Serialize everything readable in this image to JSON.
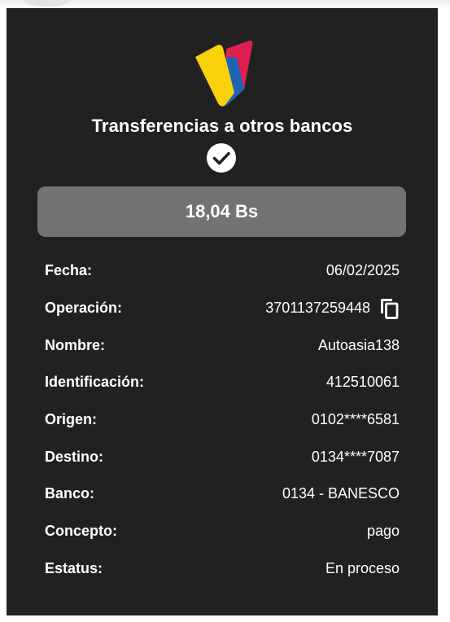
{
  "header": {
    "title": "Transferencias a otros bancos"
  },
  "summary": {
    "amount": "18,04 Bs"
  },
  "details": [
    {
      "label": "Fecha:",
      "value": "06/02/2025"
    },
    {
      "label": "Operación:",
      "value": "3701137259448"
    },
    {
      "label": "Nombre:",
      "value": "Autoasia138"
    },
    {
      "label": "Identificación:",
      "value": "412510061"
    },
    {
      "label": "Origen:",
      "value": "0102****6581"
    },
    {
      "label": "Destino:",
      "value": "0134****7087"
    },
    {
      "label": "Banco:",
      "value": "0134 - BANESCO"
    },
    {
      "label": "Concepto:",
      "value": "pago"
    },
    {
      "label": "Estatus:",
      "value": "En proceso"
    }
  ],
  "icons": {
    "logo": "bank-logo",
    "success": "check-circle-icon",
    "copy": "copy-icon"
  },
  "colors": {
    "background": "#212121",
    "amount_box": "#737373",
    "text": "#ffffff",
    "logo_yellow": "#f9d20b",
    "logo_blue": "#1d64b6",
    "logo_red": "#df1f4e"
  }
}
